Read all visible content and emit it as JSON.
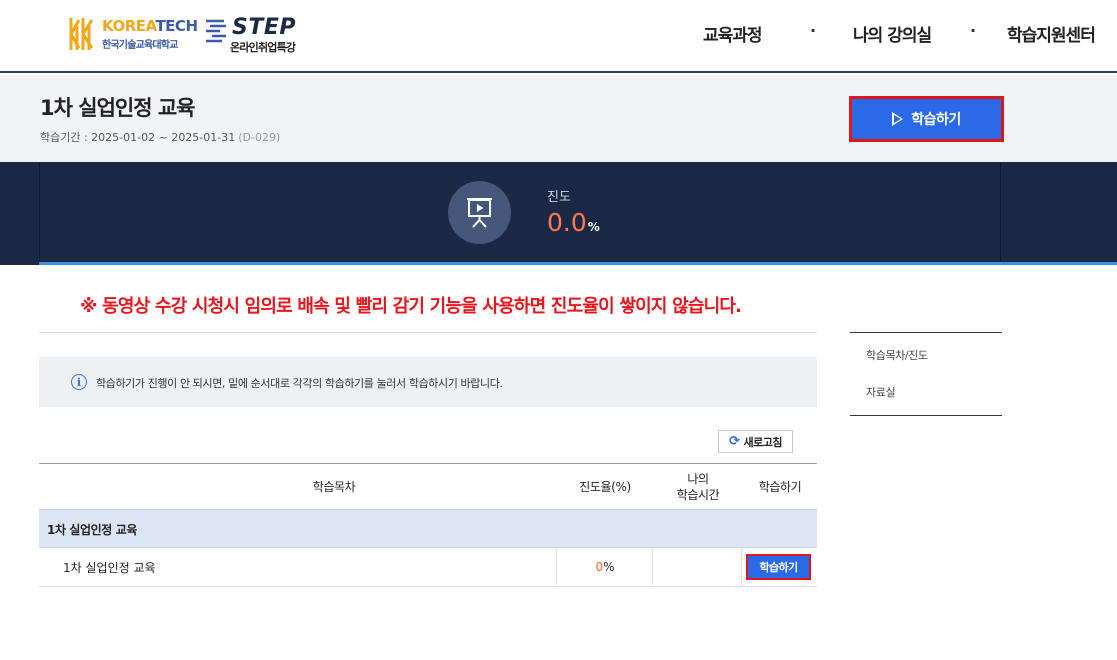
{
  "header": {
    "logo_koreatech": {
      "name_part1": "KOREA",
      "name_part2": "TECH",
      "sub": "한국기술교육대학교",
      "color_primary": "#f0a81c",
      "color_secondary": "#3b5ba8"
    },
    "logo_step": {
      "name": "STEP",
      "sub": "온라인취업특강"
    },
    "nav": [
      "교육과정",
      "나의 강의실",
      "학습지원센터"
    ],
    "nav_separator": "·"
  },
  "course": {
    "title": "1차 실업인정 교육",
    "period_label": "학습기간 : 2025-01-02 ~ 2025-01-31",
    "dday": "(D-029)",
    "study_button": "학습하기"
  },
  "progress": {
    "label": "진도",
    "value": "0.0",
    "unit": "%",
    "icon": "presentation-play-icon"
  },
  "notice": {
    "warning": "※ 동영상 수강 시청시 임의로 배속 및 빨리 감기 기능을 사용하면 진도율이 쌓이지 않습니다.",
    "info_icon": "info-icon",
    "info": "학습하기가 진행이 안 되시면, 밑에 순서대로 각각의 학습하기를 눌러서 학습하시기 바랍니다."
  },
  "refresh_button": "새로고침",
  "table": {
    "headers": {
      "contents": "학습목차",
      "rate": "진도율(%)",
      "mytime_line1": "나의",
      "mytime_line2": "학습시간",
      "study": "학습하기"
    },
    "group_label": "1차 실업인정 교육",
    "rows": [
      {
        "title": "1차 실업인정 교육",
        "rate": "0",
        "rate_unit": "%",
        "time": "",
        "button": "학습하기"
      }
    ]
  },
  "side_menu": [
    "학습목차/진도",
    "자료실"
  ],
  "colors": {
    "accent_blue": "#2a69e8",
    "warning_red": "#e8161c",
    "highlight_border": "#e0161b",
    "navy": "#1a2845",
    "progress_orange": "#ff7b4b"
  }
}
